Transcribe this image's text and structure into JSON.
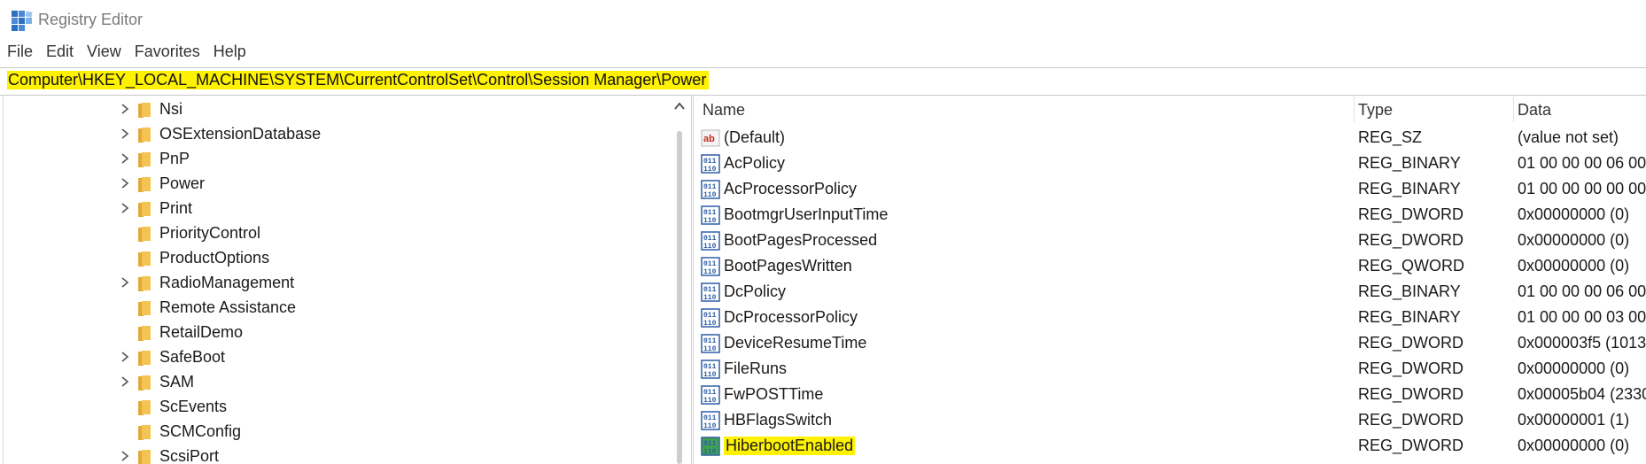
{
  "window": {
    "title": "Registry Editor"
  },
  "menu": [
    "File",
    "Edit",
    "View",
    "Favorites",
    "Help"
  ],
  "address": "Computer\\HKEY_LOCAL_MACHINE\\SYSTEM\\CurrentControlSet\\Control\\Session Manager\\Power",
  "tree": [
    {
      "label": "Nsi",
      "expandable": true
    },
    {
      "label": "OSExtensionDatabase",
      "expandable": true
    },
    {
      "label": "PnP",
      "expandable": true
    },
    {
      "label": "Power",
      "expandable": true
    },
    {
      "label": "Print",
      "expandable": true
    },
    {
      "label": "PriorityControl",
      "expandable": false
    },
    {
      "label": "ProductOptions",
      "expandable": false
    },
    {
      "label": "RadioManagement",
      "expandable": true
    },
    {
      "label": "Remote Assistance",
      "expandable": false
    },
    {
      "label": "RetailDemo",
      "expandable": false
    },
    {
      "label": "SafeBoot",
      "expandable": true
    },
    {
      "label": "SAM",
      "expandable": true
    },
    {
      "label": "ScEvents",
      "expandable": false
    },
    {
      "label": "SCMConfig",
      "expandable": false
    },
    {
      "label": "ScsiPort",
      "expandable": true
    }
  ],
  "columns": {
    "name": "Name",
    "type": "Type",
    "data": "Data"
  },
  "values": [
    {
      "name": "(Default)",
      "type": "REG_SZ",
      "data": "(value not set)",
      "icon": "string-value-icon"
    },
    {
      "name": "AcPolicy",
      "type": "REG_BINARY",
      "data": "01 00 00 00 06 00",
      "icon": "binary-value-icon"
    },
    {
      "name": "AcProcessorPolicy",
      "type": "REG_BINARY",
      "data": "01 00 00 00 00 00",
      "icon": "binary-value-icon"
    },
    {
      "name": "BootmgrUserInputTime",
      "type": "REG_DWORD",
      "data": "0x00000000 (0)",
      "icon": "binary-value-icon"
    },
    {
      "name": "BootPagesProcessed",
      "type": "REG_DWORD",
      "data": "0x00000000 (0)",
      "icon": "binary-value-icon"
    },
    {
      "name": "BootPagesWritten",
      "type": "REG_QWORD",
      "data": "0x00000000 (0)",
      "icon": "binary-value-icon"
    },
    {
      "name": "DcPolicy",
      "type": "REG_BINARY",
      "data": "01 00 00 00 06 00",
      "icon": "binary-value-icon"
    },
    {
      "name": "DcProcessorPolicy",
      "type": "REG_BINARY",
      "data": "01 00 00 00 03 00",
      "icon": "binary-value-icon"
    },
    {
      "name": "DeviceResumeTime",
      "type": "REG_DWORD",
      "data": "0x000003f5 (1013",
      "icon": "binary-value-icon"
    },
    {
      "name": "FileRuns",
      "type": "REG_DWORD",
      "data": "0x00000000 (0)",
      "icon": "binary-value-icon"
    },
    {
      "name": "FwPOSTTime",
      "type": "REG_DWORD",
      "data": "0x00005b04 (2330",
      "icon": "binary-value-icon"
    },
    {
      "name": "HBFlagsSwitch",
      "type": "REG_DWORD",
      "data": "0x00000001 (1)",
      "icon": "binary-value-icon"
    },
    {
      "name": "HiberbootEnabled",
      "type": "REG_DWORD",
      "data": "0x00000000 (0)",
      "icon": "binary-value-icon-selected",
      "highlighted": true
    }
  ],
  "colors": {
    "highlight": "#fff200",
    "folder": "#f3c453",
    "binary_icon": "#2f5fa6"
  }
}
